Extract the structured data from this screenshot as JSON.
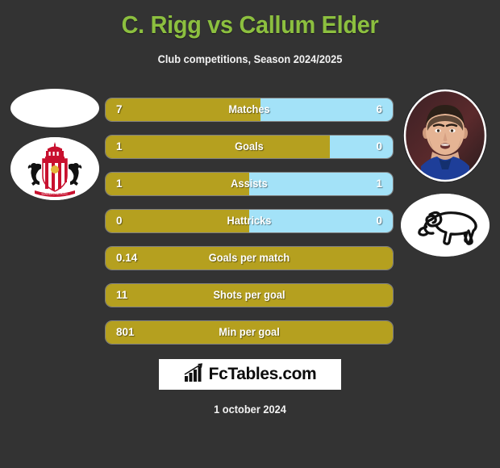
{
  "header": {
    "title": "C. Rigg vs Callum Elder",
    "subtitle": "Club competitions, Season 2024/2025",
    "title_color": "#8cbf3f"
  },
  "colors": {
    "background": "#333333",
    "left_bar": "#b5a01f",
    "right_bar": "#a3e2f8",
    "text": "#ffffff"
  },
  "left_player": {
    "photo": "player-photo-placeholder",
    "club_crest": "sunderland-afc-crest"
  },
  "right_player": {
    "photo": "callum-elder-photo",
    "club_crest": "derby-county-crest"
  },
  "stats": [
    {
      "label": "Matches",
      "left": "7",
      "right": "6",
      "left_pct": 54,
      "has_right": true
    },
    {
      "label": "Goals",
      "left": "1",
      "right": "0",
      "left_pct": 78,
      "has_right": true
    },
    {
      "label": "Assists",
      "left": "1",
      "right": "1",
      "left_pct": 50,
      "has_right": true
    },
    {
      "label": "Hattricks",
      "left": "0",
      "right": "0",
      "left_pct": 50,
      "has_right": true
    },
    {
      "label": "Goals per match",
      "left": "0.14",
      "right": "",
      "left_pct": 100,
      "has_right": false
    },
    {
      "label": "Shots per goal",
      "left": "11",
      "right": "",
      "left_pct": 100,
      "has_right": false
    },
    {
      "label": "Min per goal",
      "left": "801",
      "right": "",
      "left_pct": 100,
      "has_right": false
    }
  ],
  "footer": {
    "logo_text": "FcTables.com",
    "logo_icon": "bar-chart-arrow-icon",
    "date": "1 october 2024"
  }
}
